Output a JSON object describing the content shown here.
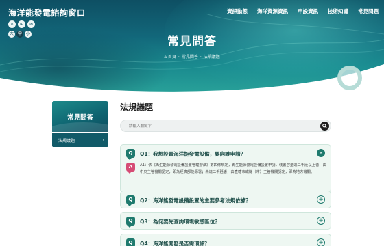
{
  "header": {
    "site_title": "海洋能發電諮詢窗口",
    "util_icons": [
      "home-icon",
      "sitemap-icon",
      "mail-icon"
    ],
    "languages": [
      "大",
      "中",
      "小"
    ],
    "active_language": "中",
    "nav": [
      "資訊動態",
      "海洋資源資訊",
      "申設資訊",
      "技術知識",
      "常見問題"
    ]
  },
  "hero": {
    "title": "常見問答",
    "breadcrumb": [
      "首頁",
      "常見問答",
      "法規議題"
    ]
  },
  "sidebar": {
    "title": "常見問答",
    "items": [
      {
        "label": "法規議題"
      }
    ]
  },
  "main": {
    "title": "法規議題",
    "search_placeholder": "請輸入關鍵字",
    "faqs": [
      {
        "question": "Q1：我想設置海洋能發電設備，要向誰申請？",
        "expanded": true,
        "answer": "A1：依《再生能源發電設備設置管理辦法》第四條規定，再生能源發電設備設置申請，裝置容量達二千瓩以上者，由中央主管機關認定，即為經濟部能源署；未達二千瓩者，由直轄市或縣（市）主管機關認定，即為地方機關。"
      },
      {
        "question": "Q2：海洋能發電設備設置的主要參考法規依據？",
        "expanded": false
      },
      {
        "question": "Q3：為何要先查詢環境敏感區位？",
        "expanded": false
      },
      {
        "question": "Q4：海洋能開發是否需環評？",
        "expanded": false
      }
    ]
  },
  "colors": {
    "brand_teal": "#1f7a6e",
    "answer_pink": "#d64c75",
    "sidebar_active": "#115a68",
    "faq_bg": "#eef7f2"
  }
}
